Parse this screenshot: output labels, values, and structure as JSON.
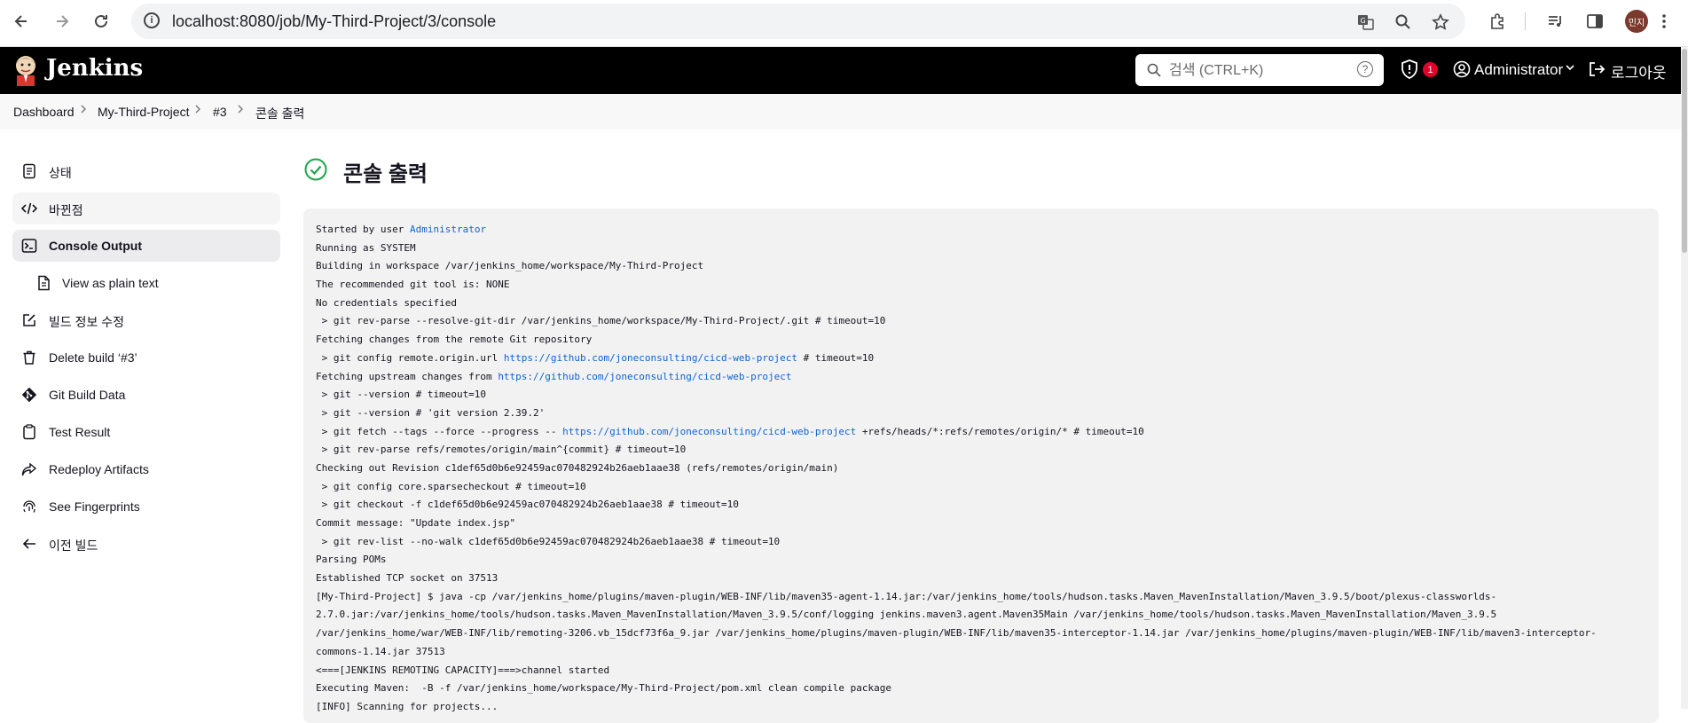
{
  "browser": {
    "url": "localhost:8080/job/My-Third-Project/3/console",
    "profile_initials": "민지"
  },
  "header": {
    "app_title": "Jenkins",
    "search_placeholder": "검색 (CTRL+K)",
    "help_glyph": "?",
    "security_badge_count": "1",
    "user_name": "Administrator",
    "logout_label": "로그아웃"
  },
  "breadcrumb": [
    "Dashboard",
    "My-Third-Project",
    "#3",
    "콘솔 출력"
  ],
  "sidebar": {
    "items": [
      {
        "label": "상태",
        "icon": "document-icon"
      },
      {
        "label": "바뀐점",
        "icon": "code-icon"
      },
      {
        "label": "Console Output",
        "icon": "terminal-icon"
      },
      {
        "label": "View as plain text",
        "icon": "file-icon"
      },
      {
        "label": "빌드 정보 수정",
        "icon": "edit-icon"
      },
      {
        "label": "Delete build ‘#3’",
        "icon": "trash-icon"
      },
      {
        "label": "Git Build Data",
        "icon": "git-icon"
      },
      {
        "label": "Test Result",
        "icon": "clipboard-icon"
      },
      {
        "label": "Redeploy Artifacts",
        "icon": "redeploy-icon"
      },
      {
        "label": "See Fingerprints",
        "icon": "fingerprint-icon"
      },
      {
        "label": "이전 빌드",
        "icon": "arrow-left-icon"
      }
    ]
  },
  "main": {
    "title": "콘솔 출력",
    "status_color": "#1ea64b"
  },
  "console": {
    "lines": [
      [
        {
          "t": "Started by user "
        },
        {
          "t": "Administrator",
          "link": true
        }
      ],
      [
        {
          "t": "Running as SYSTEM"
        }
      ],
      [
        {
          "t": "Building in workspace /var/jenkins_home/workspace/My-Third-Project"
        }
      ],
      [
        {
          "t": "The recommended git tool is: NONE"
        }
      ],
      [
        {
          "t": "No credentials specified"
        }
      ],
      [
        {
          "t": " > git rev-parse --resolve-git-dir /var/jenkins_home/workspace/My-Third-Project/.git # timeout=10"
        }
      ],
      [
        {
          "t": "Fetching changes from the remote Git repository"
        }
      ],
      [
        {
          "t": " > git config remote.origin.url "
        },
        {
          "t": "https://github.com/joneconsulting/cicd-web-project",
          "link": true
        },
        {
          "t": " # timeout=10"
        }
      ],
      [
        {
          "t": "Fetching upstream changes from "
        },
        {
          "t": "https://github.com/joneconsulting/cicd-web-project",
          "link": true
        }
      ],
      [
        {
          "t": " > git --version # timeout=10"
        }
      ],
      [
        {
          "t": " > git --version # 'git version 2.39.2'"
        }
      ],
      [
        {
          "t": " > git fetch --tags --force --progress -- "
        },
        {
          "t": "https://github.com/joneconsulting/cicd-web-project",
          "link": true
        },
        {
          "t": " +refs/heads/*:refs/remotes/origin/* # timeout=10"
        }
      ],
      [
        {
          "t": " > git rev-parse refs/remotes/origin/main^{commit} # timeout=10"
        }
      ],
      [
        {
          "t": "Checking out Revision c1def65d0b6e92459ac070482924b26aeb1aae38 (refs/remotes/origin/main)"
        }
      ],
      [
        {
          "t": " > git config core.sparsecheckout # timeout=10"
        }
      ],
      [
        {
          "t": " > git checkout -f c1def65d0b6e92459ac070482924b26aeb1aae38 # timeout=10"
        }
      ],
      [
        {
          "t": "Commit message: \"Update index.jsp\""
        }
      ],
      [
        {
          "t": " > git rev-list --no-walk c1def65d0b6e92459ac070482924b26aeb1aae38 # timeout=10"
        }
      ],
      [
        {
          "t": "Parsing POMs"
        }
      ],
      [
        {
          "t": "Established TCP socket on 37513"
        }
      ],
      [
        {
          "t": "[My-Third-Project] $ java -cp /var/jenkins_home/plugins/maven-plugin/WEB-INF/lib/maven35-agent-1.14.jar:/var/jenkins_home/tools/hudson.tasks.Maven_MavenInstallation/Maven_3.9.5/boot/plexus-classworlds-"
        }
      ],
      [
        {
          "t": "2.7.0.jar:/var/jenkins_home/tools/hudson.tasks.Maven_MavenInstallation/Maven_3.9.5/conf/logging jenkins.maven3.agent.Maven35Main /var/jenkins_home/tools/hudson.tasks.Maven_MavenInstallation/Maven_3.9.5"
        }
      ],
      [
        {
          "t": "/var/jenkins_home/war/WEB-INF/lib/remoting-3206.vb_15dcf73f6a_9.jar /var/jenkins_home/plugins/maven-plugin/WEB-INF/lib/maven35-interceptor-1.14.jar /var/jenkins_home/plugins/maven-plugin/WEB-INF/lib/maven3-interceptor-"
        }
      ],
      [
        {
          "t": "commons-1.14.jar 37513"
        }
      ],
      [
        {
          "t": "<===[JENKINS REMOTING CAPACITY]===>channel started"
        }
      ],
      [
        {
          "t": "Executing Maven:  -B -f /var/jenkins_home/workspace/My-Third-Project/pom.xml clean compile package"
        }
      ],
      [
        {
          "t": "[INFO] Scanning for projects..."
        }
      ]
    ]
  }
}
